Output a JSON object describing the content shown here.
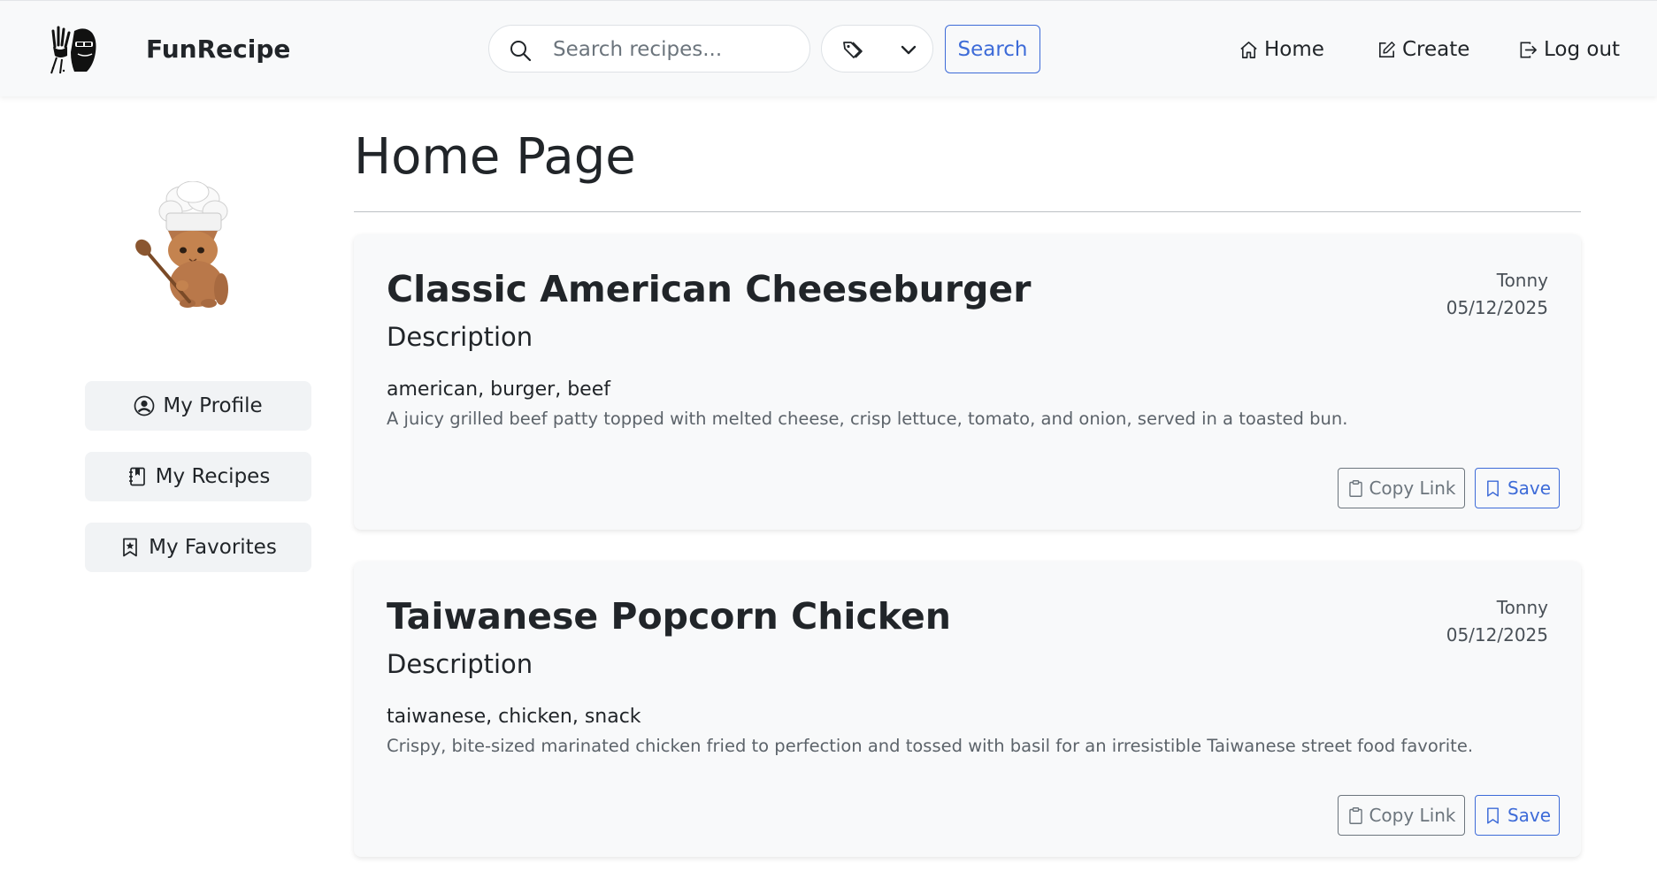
{
  "navbar": {
    "brand": "FunRecipe",
    "search": {
      "placeholder": "Search recipes...",
      "value": ""
    },
    "search_button": "Search",
    "links": {
      "home": "Home",
      "create": "Create",
      "logout": "Log out"
    }
  },
  "sidebar": {
    "items": [
      {
        "label": "My Profile",
        "icon": "person-circle-icon"
      },
      {
        "label": "My Recipes",
        "icon": "journal-bookmark-icon"
      },
      {
        "label": "My Favorites",
        "icon": "bookmark-star-icon"
      }
    ]
  },
  "main": {
    "title": "Home Page",
    "recipes": [
      {
        "title": "Classic American Cheeseburger",
        "description_heading": "Description",
        "tags": "american, burger, beef",
        "description": "A juicy grilled beef patty topped with melted cheese, crisp lettuce, tomato, and onion, served in a toasted bun.",
        "author": "Tonny",
        "date": "05/12/2025",
        "copy_label": "Copy Link",
        "save_label": "Save"
      },
      {
        "title": "Taiwanese Popcorn Chicken",
        "description_heading": "Description",
        "tags": "taiwanese, chicken, snack",
        "description": "Crispy, bite-sized marinated chicken fried to perfection and tossed with basil for an irresistible Taiwanese street food favorite.",
        "author": "Tonny",
        "date": "05/12/2025",
        "copy_label": "Copy Link",
        "save_label": "Save"
      }
    ]
  },
  "colors": {
    "primary": "#3d6bd8",
    "secondary": "#6c757d",
    "navbar_bg": "#f8f9fa",
    "card_bg": "#f8f9fa"
  }
}
